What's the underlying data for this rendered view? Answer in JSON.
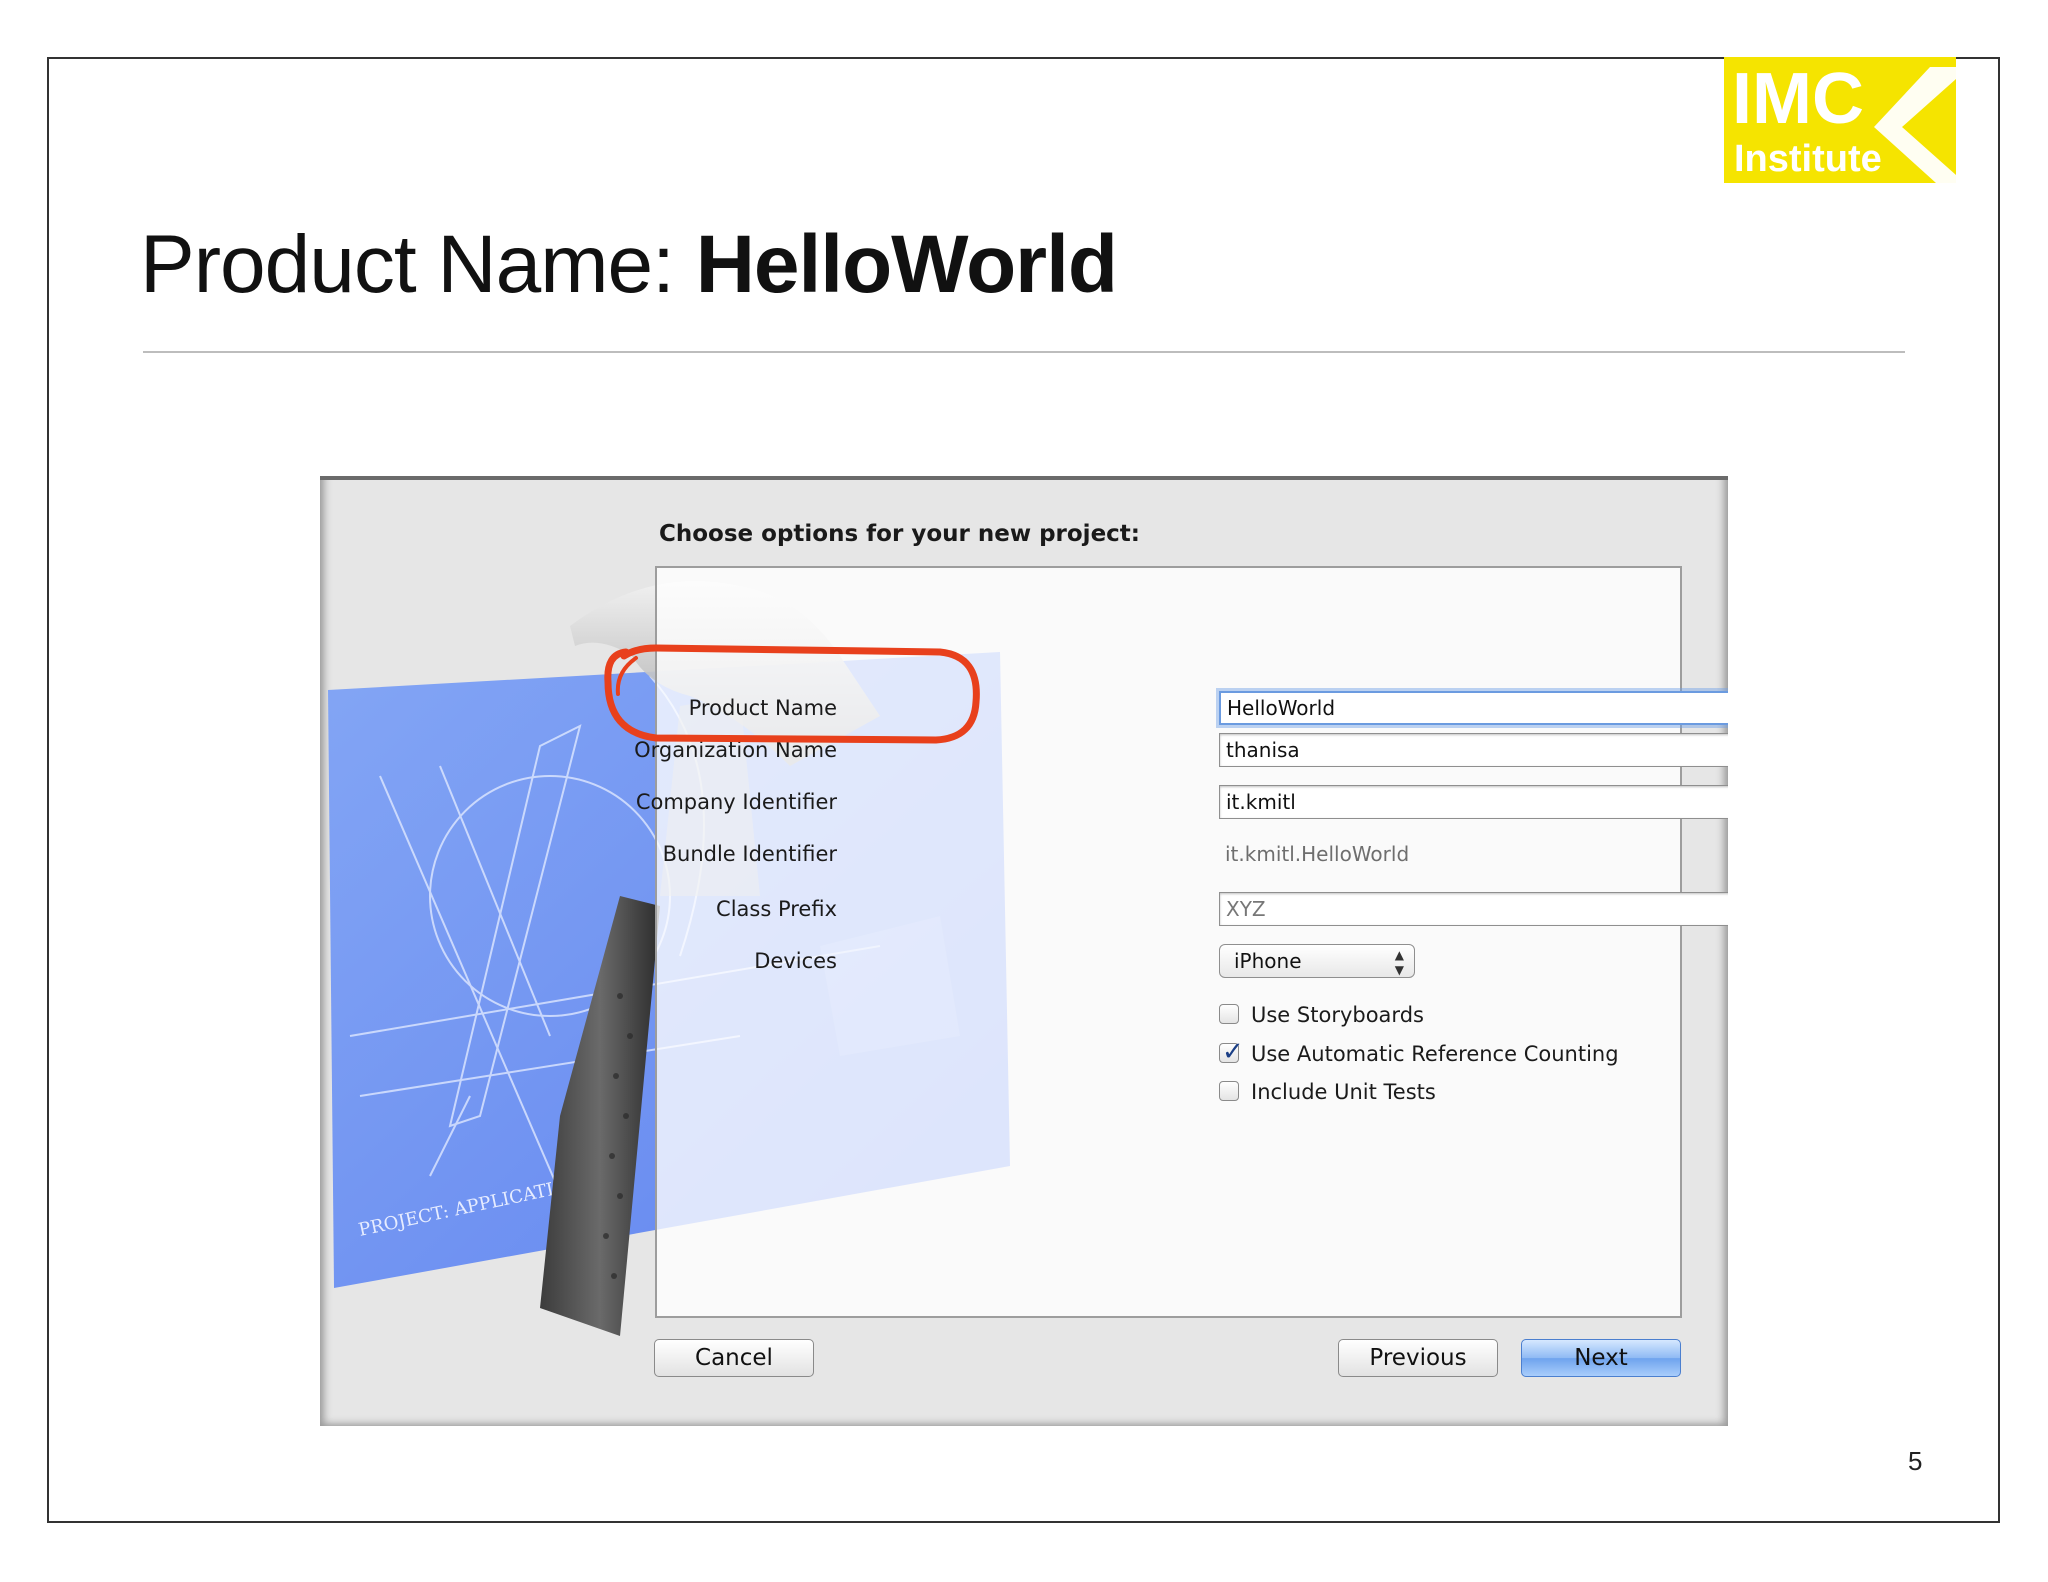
{
  "slide": {
    "title_prefix": "Product Name: ",
    "title_bold": "HelloWorld",
    "page_number": "5",
    "logo": {
      "text_main": "IMC",
      "text_sub": "Institute",
      "background": "#f5e400",
      "icon": "chevron-left-logo"
    }
  },
  "dialog": {
    "heading": "Choose options for your new project:",
    "fields": {
      "product_name": {
        "label": "Product Name",
        "value": "HelloWorld"
      },
      "organization_name": {
        "label": "Organization Name",
        "value": "thanisa"
      },
      "company_identifier": {
        "label": "Company Identifier",
        "value": "it.kmitl"
      },
      "bundle_identifier": {
        "label": "Bundle Identifier",
        "value": "it.kmitl.HelloWorld"
      },
      "class_prefix": {
        "label": "Class Prefix",
        "placeholder": "XYZ"
      },
      "devices": {
        "label": "Devices",
        "selected": "iPhone"
      }
    },
    "options": [
      {
        "label": "Use Storyboards",
        "checked": false
      },
      {
        "label": "Use Automatic Reference Counting",
        "checked": true
      },
      {
        "label": "Include Unit Tests",
        "checked": false
      }
    ],
    "buttons": {
      "cancel": "Cancel",
      "previous": "Previous",
      "next": "Next"
    },
    "background_text": {
      "blueprint_label": "PROJECT: APPLICATION.APP"
    },
    "colors": {
      "highlight_ring": "#e8401c",
      "focus_ring": "#6b9be0",
      "next_button": "#7fb0f2"
    }
  }
}
